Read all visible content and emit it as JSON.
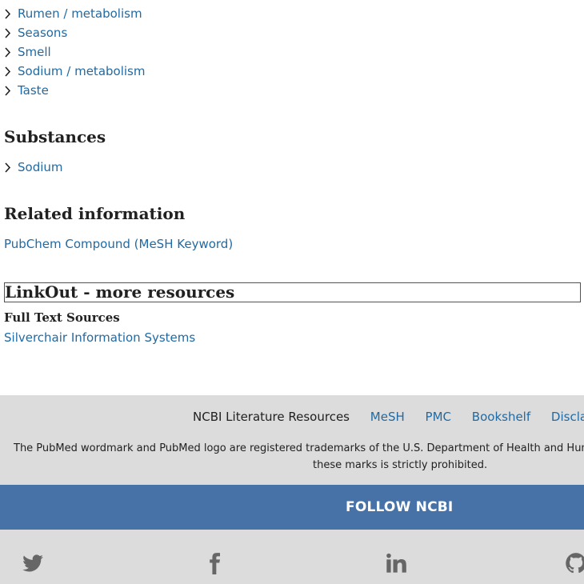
{
  "mesh_terms": [
    {
      "label": "Rumen / metabolism"
    },
    {
      "label": "Seasons"
    },
    {
      "label": "Smell"
    },
    {
      "label": "Sodium / metabolism"
    },
    {
      "label": "Taste"
    }
  ],
  "substances": {
    "heading": "Substances",
    "items": [
      {
        "label": "Sodium"
      }
    ]
  },
  "related": {
    "heading": "Related information",
    "link": "PubChem Compound (MeSH Keyword)"
  },
  "linkout": {
    "heading": "LinkOut - more resources",
    "subheading": "Full Text Sources",
    "link": "Silverchair Information Systems"
  },
  "footer": {
    "links": [
      "NCBI Literature Resources",
      "MeSH",
      "PMC",
      "Bookshelf",
      "Disclaimer"
    ],
    "trademark_line1": "The PubMed wordmark and PubMed logo are registered trademarks of the U.S. Department of Health and Human Services. Unauthorized use of",
    "trademark_line2": "these marks is strictly prohibited.",
    "follow_label": "FOLLOW NCBI"
  },
  "social": [
    {
      "icon": "twitter-icon"
    },
    {
      "icon": "facebook-icon"
    },
    {
      "icon": "linkedin-icon"
    },
    {
      "icon": "github-icon"
    }
  ],
  "colors": {
    "link": "#216aa3",
    "heading": "#212121",
    "footer_bg": "#dcdcdc",
    "follow_bg": "#4672a8",
    "focus_outline": "#c41e26"
  }
}
